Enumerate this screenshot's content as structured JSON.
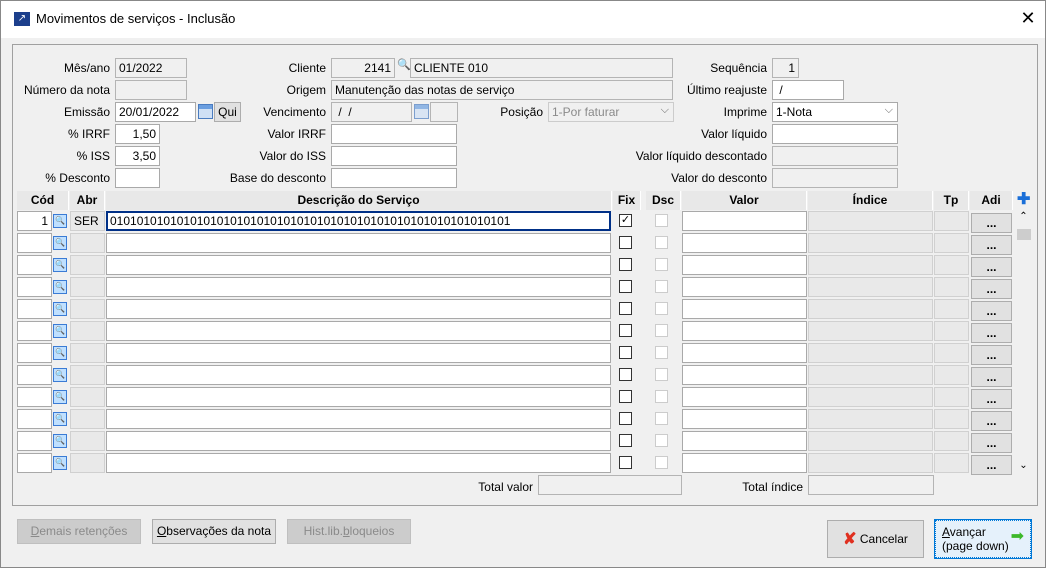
{
  "window": {
    "title": "Movimentos de serviços - Inclusão",
    "close": "✕"
  },
  "form": {
    "mes_ano": {
      "label": "Mês/ano",
      "value": "01/2022"
    },
    "numero_nota": {
      "label": "Número da nota",
      "value": ""
    },
    "emissao": {
      "label": "Emissão",
      "value": "20/01/2022",
      "weekday": "Qui"
    },
    "irrf_pct": {
      "label": "% IRRF",
      "value": "1,50"
    },
    "iss_pct": {
      "label": "% ISS",
      "value": "3,50"
    },
    "desconto_pct": {
      "label": "% Desconto",
      "value": ""
    },
    "cliente": {
      "label": "Cliente",
      "code": "2141",
      "name": "CLIENTE 010"
    },
    "origem": {
      "label": "Origem",
      "value": "Manutenção das notas de serviço"
    },
    "vencimento": {
      "label": "Vencimento",
      "value": " /  /"
    },
    "valor_irrf": {
      "label": "Valor IRRF",
      "value": ""
    },
    "valor_iss": {
      "label": "Valor do ISS",
      "value": ""
    },
    "base_desconto": {
      "label": "Base do desconto",
      "value": ""
    },
    "posicao": {
      "label": "Posição",
      "value": "1-Por faturar"
    },
    "sequencia": {
      "label": "Sequência",
      "value": "1"
    },
    "ultimo_reajuste": {
      "label": "Último reajuste",
      "value": " /"
    },
    "imprime": {
      "label": "Imprime",
      "value": "1-Nota"
    },
    "valor_liquido": {
      "label": "Valor líquido",
      "value": ""
    },
    "valor_liquido_desc": {
      "label": "Valor líquido descontado",
      "value": ""
    },
    "valor_desconto": {
      "label": "Valor do desconto",
      "value": ""
    }
  },
  "grid": {
    "columns": [
      "Cód",
      "Abr",
      "Descrição do Serviço",
      "Fix",
      "Dsc",
      "Valor",
      "Índice",
      "Tp",
      "Adi"
    ],
    "adi_label": "...",
    "rows": [
      {
        "cod": "1",
        "abr": "SER",
        "desc": "010101010101010101010101010101010101010101010101010101010101",
        "fix": true
      },
      {
        "cod": "",
        "abr": "",
        "desc": "",
        "fix": false
      },
      {
        "cod": "",
        "abr": "",
        "desc": "",
        "fix": false
      },
      {
        "cod": "",
        "abr": "",
        "desc": "",
        "fix": false
      },
      {
        "cod": "",
        "abr": "",
        "desc": "",
        "fix": false
      },
      {
        "cod": "",
        "abr": "",
        "desc": "",
        "fix": false
      },
      {
        "cod": "",
        "abr": "",
        "desc": "",
        "fix": false
      },
      {
        "cod": "",
        "abr": "",
        "desc": "",
        "fix": false
      },
      {
        "cod": "",
        "abr": "",
        "desc": "",
        "fix": false
      },
      {
        "cod": "",
        "abr": "",
        "desc": "",
        "fix": false
      },
      {
        "cod": "",
        "abr": "",
        "desc": "",
        "fix": false
      },
      {
        "cod": "",
        "abr": "",
        "desc": "",
        "fix": false
      }
    ]
  },
  "totals": {
    "total_valor": {
      "label": "Total valor",
      "value": ""
    },
    "total_indice": {
      "label": "Total índice",
      "value": ""
    }
  },
  "buttons": {
    "demais": {
      "u": "D",
      "rest": "emais retenções"
    },
    "observacoes": {
      "u": "O",
      "rest": "bservações da nota"
    },
    "hist": {
      "a": "Hist.lib.",
      "u": "b",
      "rest": "loqueios"
    },
    "cancelar": "Cancelar",
    "avancar": {
      "u": "A",
      "rest": "vançar",
      "line2": "(page down)"
    }
  },
  "colors": {
    "accent": "#003087"
  }
}
